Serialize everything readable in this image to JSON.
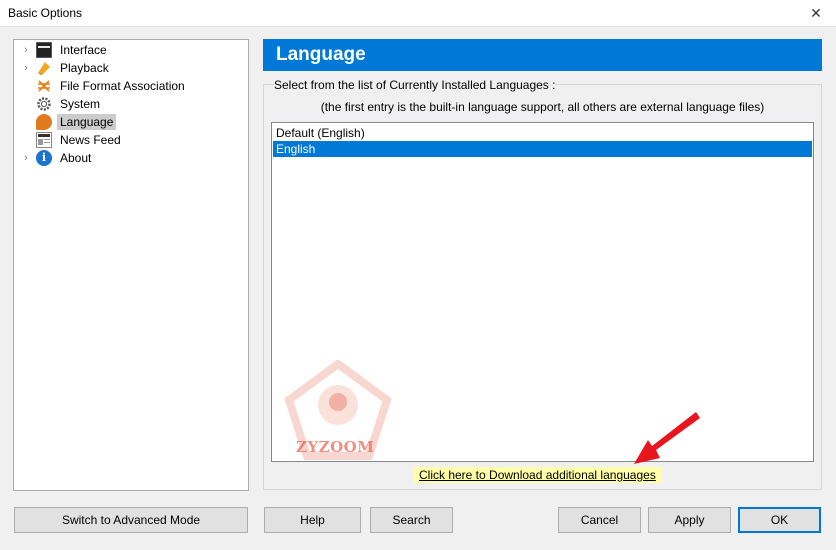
{
  "window": {
    "title": "Basic Options",
    "close_glyph": "✕"
  },
  "tree": [
    {
      "label": "Interface",
      "expandable": true,
      "icon": "interface-icon"
    },
    {
      "label": "Playback",
      "expandable": true,
      "icon": "playback-icon"
    },
    {
      "label": "File Format Association",
      "expandable": false,
      "icon": "file-format-icon"
    },
    {
      "label": "System",
      "expandable": false,
      "icon": "system-gear-icon"
    },
    {
      "label": "Language",
      "expandable": false,
      "icon": "language-icon",
      "selected": true
    },
    {
      "label": "News Feed",
      "expandable": false,
      "icon": "news-icon"
    },
    {
      "label": "About",
      "expandable": true,
      "icon": "info-icon"
    }
  ],
  "panel": {
    "title": "Language",
    "caption": "Select from the list of Currently Installed Languages :",
    "subcaption": "(the first entry is the built-in language support, all others are external language files)",
    "languages": [
      "Default (English)",
      "English"
    ],
    "selected_language": "English",
    "download_link": "Click here to Download additional languages"
  },
  "watermark": {
    "text": "ZYZOOM"
  },
  "buttons": {
    "advanced": "Switch to Advanced Mode",
    "help": "Help",
    "search": "Search",
    "cancel": "Cancel",
    "apply": "Apply",
    "ok": "OK"
  },
  "colors": {
    "accent": "#0078d7",
    "link_highlight": "#ffffaa",
    "arrow": "#e8141e"
  }
}
